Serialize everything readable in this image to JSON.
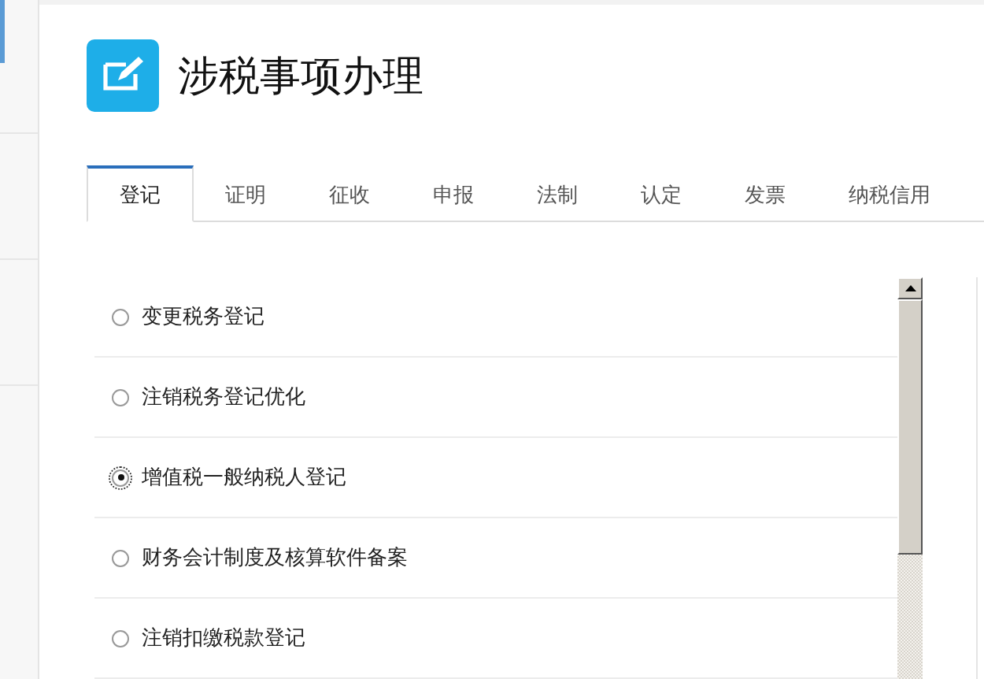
{
  "page": {
    "title": "涉税事项办理"
  },
  "tabs": [
    {
      "label": "登记",
      "selected": true
    },
    {
      "label": "证明",
      "selected": false
    },
    {
      "label": "征收",
      "selected": false
    },
    {
      "label": "申报",
      "selected": false
    },
    {
      "label": "法制",
      "selected": false
    },
    {
      "label": "认定",
      "selected": false
    },
    {
      "label": "发票",
      "selected": false
    },
    {
      "label": "纳税信用",
      "selected": false
    }
  ],
  "items": [
    {
      "label": "变更税务登记",
      "selected": false
    },
    {
      "label": "注销税务登记优化",
      "selected": false
    },
    {
      "label": "增值税一般纳税人登记",
      "selected": true
    },
    {
      "label": "财务会计制度及核算软件备案",
      "selected": false
    },
    {
      "label": "注销扣缴税款登记",
      "selected": false
    }
  ]
}
